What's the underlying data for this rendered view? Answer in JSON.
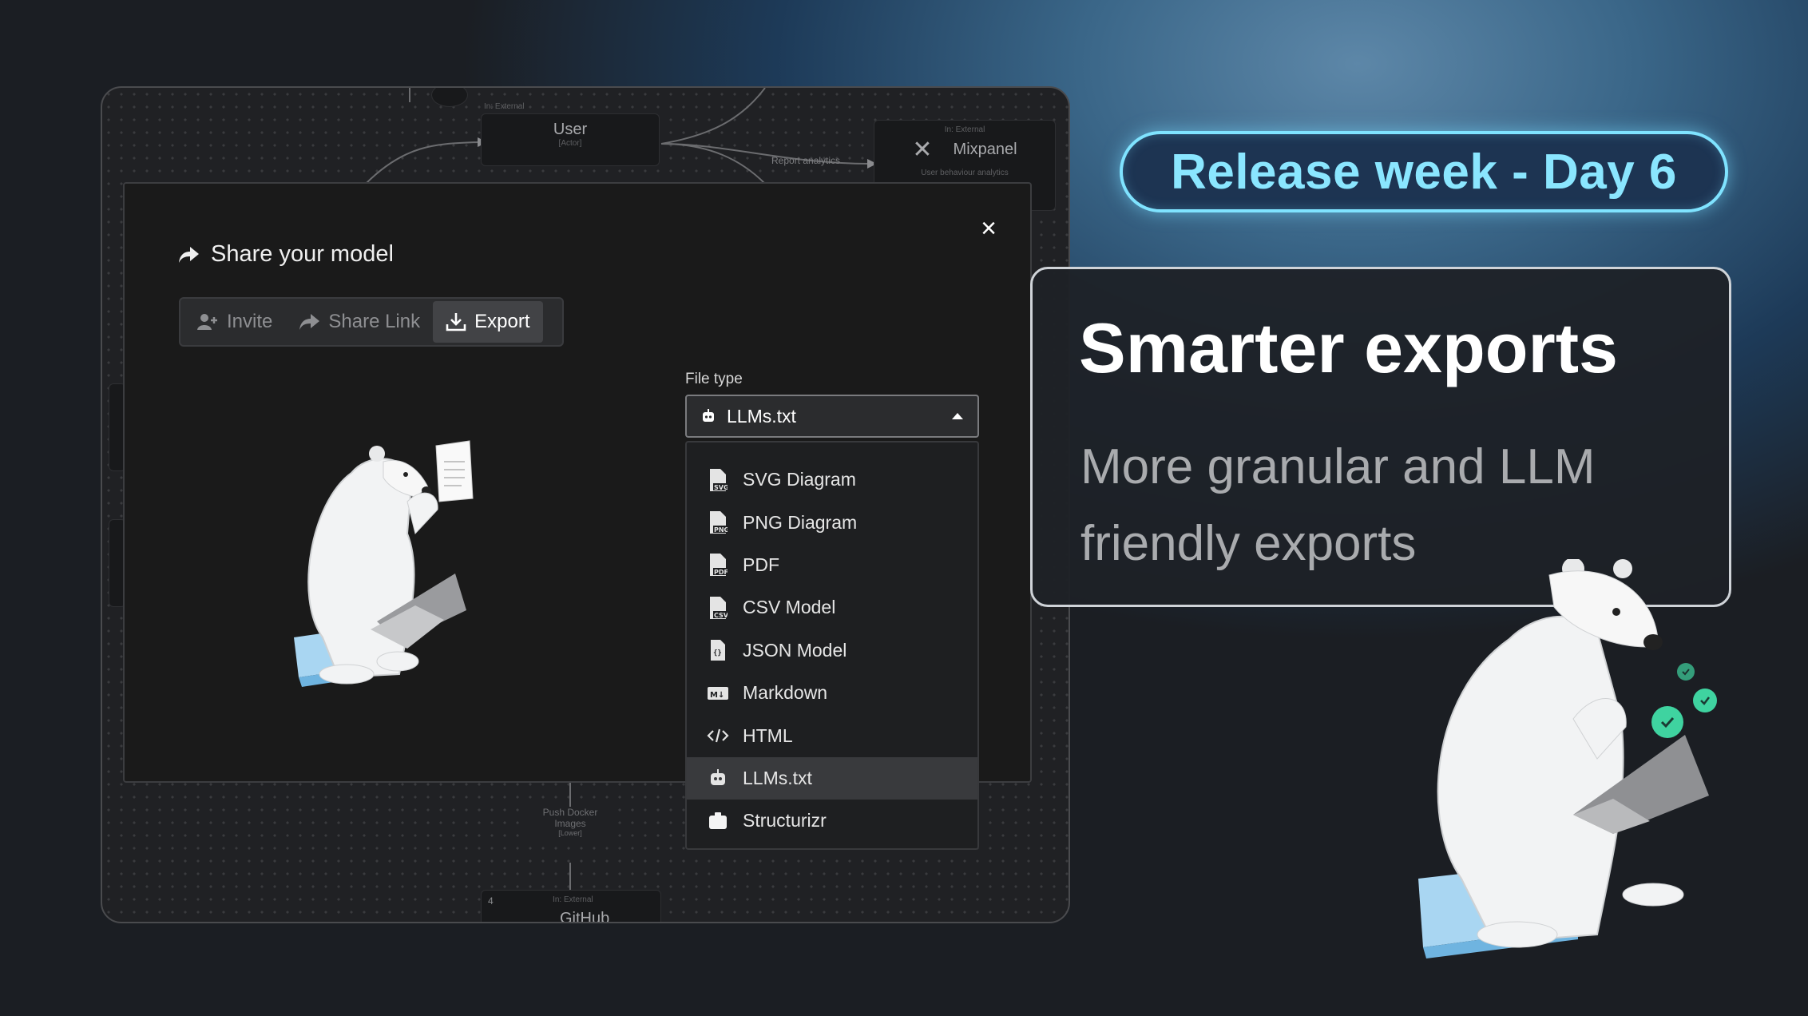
{
  "badge": {
    "text": "Release week - Day 6"
  },
  "card": {
    "title": "Smarter exports",
    "subtitle": "More granular and LLM friendly exports"
  },
  "diagram": {
    "user_node": {
      "tag": "In: External",
      "name": "User",
      "sub": "[Actor]"
    },
    "mixpanel_node": {
      "tag": "In: External",
      "name": "Mixpanel",
      "sub": "User behaviour analytics"
    },
    "edge_report": "Report analytics",
    "edge_push": {
      "line1": "Push Docker",
      "line2": "Images",
      "line3": "[Lower]"
    },
    "github_node": {
      "tag": "In: External",
      "count": "4",
      "name": "GitHub"
    }
  },
  "dialog": {
    "title": "Share your model",
    "close_label": "×",
    "tabs": [
      {
        "label": "Invite",
        "icon": "add-user-icon"
      },
      {
        "label": "Share Link",
        "icon": "share-icon"
      },
      {
        "label": "Export",
        "icon": "download-icon",
        "active": true
      }
    ],
    "file_type_label": "File type",
    "selected_value": "LLMs.txt",
    "options": [
      {
        "label": "SVG Diagram",
        "icon": "svg-file-icon",
        "badge": "SVG"
      },
      {
        "label": "PNG Diagram",
        "icon": "png-file-icon",
        "badge": "PNG"
      },
      {
        "label": "PDF",
        "icon": "pdf-file-icon",
        "badge": "PDF"
      },
      {
        "label": "CSV Model",
        "icon": "csv-file-icon",
        "badge": "CSV"
      },
      {
        "label": "JSON Model",
        "icon": "json-file-icon",
        "badge": ""
      },
      {
        "label": "Markdown",
        "icon": "markdown-icon",
        "badge": "M↓"
      },
      {
        "label": "HTML",
        "icon": "code-icon",
        "badge": "</>"
      },
      {
        "label": "LLMs.txt",
        "icon": "robot-icon",
        "badge": "",
        "selected": true
      },
      {
        "label": "Structurizr",
        "icon": "structurizr-icon",
        "badge": ""
      }
    ]
  },
  "colors": {
    "accent": "#7fe3ff",
    "bg_dark": "#1b1e23",
    "dialog": "#1a1a1a",
    "check": "#3fd3a0"
  }
}
